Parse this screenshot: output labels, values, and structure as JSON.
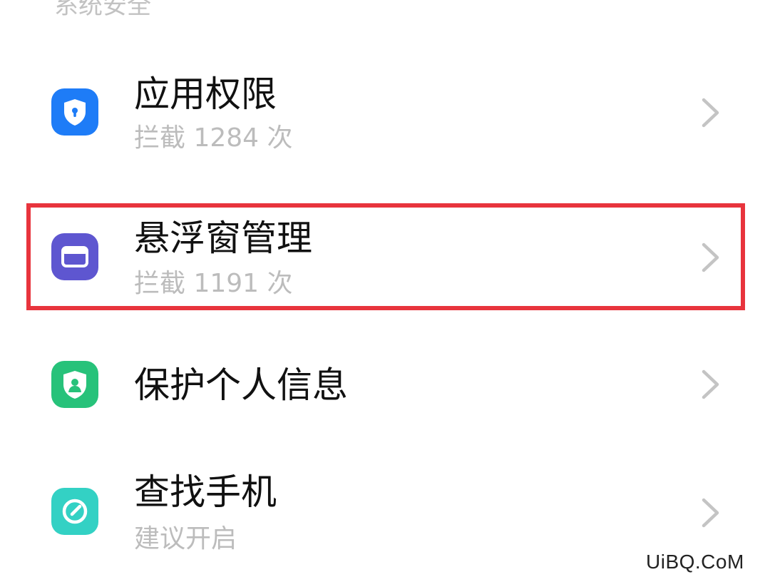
{
  "section_header": "系统安全",
  "items": [
    {
      "title": "应用权限",
      "subtitle": "拦截 1284 次",
      "icon": "shield-lock-icon",
      "color": "#1e7cf7"
    },
    {
      "title": "悬浮窗管理",
      "subtitle": "拦截 1191 次",
      "icon": "floating-window-icon",
      "color": "#5e56d0"
    },
    {
      "title": "保护个人信息",
      "subtitle": "",
      "icon": "shield-person-icon",
      "color": "#27c27a"
    },
    {
      "title": "查找手机",
      "subtitle": "建议开启",
      "icon": "find-phone-icon",
      "color": "#33d1c4"
    }
  ],
  "highlight_color": "#e8343d",
  "watermark": "UiBQ.CoM"
}
